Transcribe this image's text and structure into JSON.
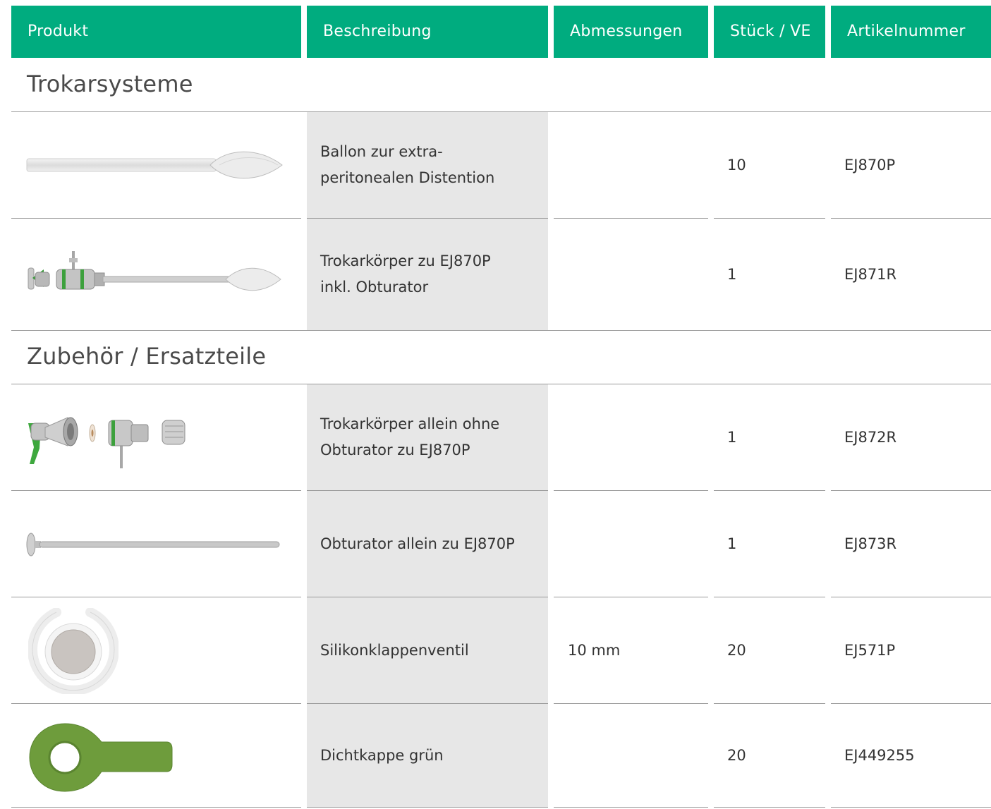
{
  "header": {
    "product": "Produkt",
    "description": "Beschreibung",
    "dimensions": "Abmessungen",
    "units": "Stück / VE",
    "article": "Artikelnummer"
  },
  "sections": [
    {
      "title": "Trokarsysteme"
    },
    {
      "title": "Zubehör / Ersatzteile"
    }
  ],
  "rows": [
    {
      "image": "balloon-trocar-icon",
      "description": "Ballon zur extra-\nperitonealen Distention",
      "dimensions": "",
      "units": "10",
      "article": "EJ870P"
    },
    {
      "image": "trocar-body-icon",
      "description": "Trokarkörper zu EJ870P\ninkl. Obturator",
      "dimensions": "",
      "units": "1",
      "article": "EJ871R"
    },
    {
      "image": "trocar-parts-icon",
      "description": "Trokarkörper allein ohne\nObturator zu EJ870P",
      "dimensions": "",
      "units": "1",
      "article": "EJ872R"
    },
    {
      "image": "obturator-icon",
      "description": "Obturator allein zu EJ870P",
      "dimensions": "",
      "units": "1",
      "article": "EJ873R"
    },
    {
      "image": "silicone-valve-icon",
      "description": "Silikonklappenventil",
      "dimensions": "10 mm",
      "units": "20",
      "article": "EJ571P"
    },
    {
      "image": "green-seal-cap-icon",
      "description": "Dichtkappe grün",
      "dimensions": "",
      "units": "20",
      "article": "EJ449255"
    }
  ],
  "colors": {
    "header_bg": "#00ac7f",
    "description_bg": "#e7e7e7",
    "accent_green": "#6a9a3a"
  }
}
